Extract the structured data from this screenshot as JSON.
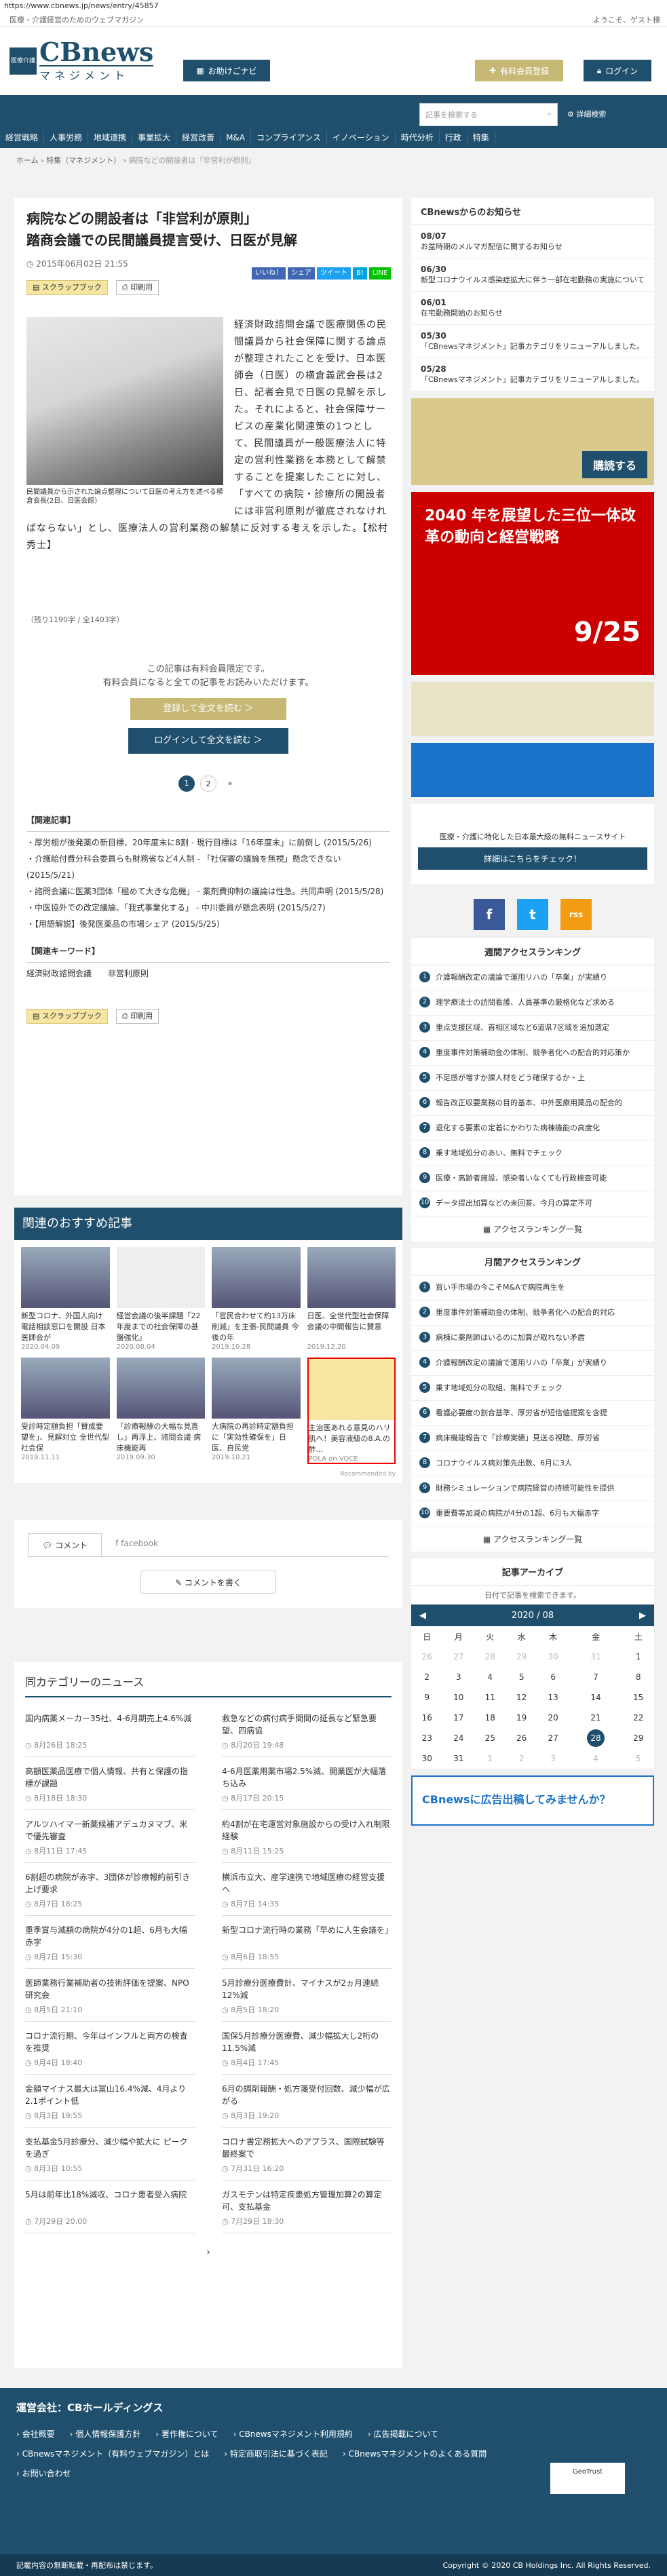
{
  "url": "https://www.cbnews.jp/news/entry/45857",
  "top": {
    "tagline": "医療・介護経営のためのウェブマガジン",
    "welcome": "ようこそ、ゲスト様"
  },
  "header": {
    "logo_badge": "医療介護",
    "logo_name": "CBnews",
    "logo_sub": "マネジメント",
    "nav_btn": "お助けごナビ",
    "paid": "有料会員登録",
    "login": "ログイン"
  },
  "nav": {
    "search_placeholder": "記事を検索する",
    "advanced": "詳細検索",
    "items": [
      "経営戦略",
      "人事労務",
      "地域連携",
      "事業拡大",
      "経営改善",
      "M&A",
      "コンプライアンス",
      "イノベーション",
      "時代分析",
      "行政",
      "特集"
    ]
  },
  "breadcrumb": {
    "home": "ホーム",
    "section": "特集（マネジメント）",
    "current": "病院などの開設者は「非営利が原則」"
  },
  "article": {
    "title1": "病院などの開設者は「非営利が原則」",
    "title2": "踏商会議での民間議員提言受け、日医が見解",
    "date": "2015年06月02日 21:55",
    "share": [
      "いいね！",
      "シェア",
      "ツイート",
      "B!",
      "LINE"
    ],
    "scrap": "スクラップブック",
    "print": "印刷用",
    "caption": "民間議員から示された論点整理について日医の考え方を述べる横倉会長(2日、日医会館)",
    "body": "経済財政諮問会議で医療関係の民間議員から社会保障に関する論点が整理されたことを受け、日本医師会（日医）の横倉義武会長は2日、記者会見で日医の見解を示した。それによると、社会保障サービスの産業化関連策の1つとして、民間議員が一般医療法人に特定の営利性業務を本務として解禁することを提案したことに対し、「すべての病院・診療所の開設者には非営利原則が徹底されなければならない」とし、医療法人の営利業務の解禁に反対する考えを示した。【松村秀士】",
    "remain": "（残り1190字 / 全1403字）",
    "members1": "この記事は有料会員限定です。",
    "members2": "有料会員になると全ての記事をお読みいただけます。",
    "read_btn": "登録して全文を読む ＞",
    "login_btn": "ログインして全文を読む ＞",
    "pages": [
      "1",
      "2",
      "»"
    ],
    "related_h": "【関連記事】",
    "related": [
      "厚労相が後発薬の新目標、20年度末に8割 - 現行目標は「16年度末」に前倒し (2015/5/26)",
      "介護給付費分科会委員らも財務省など4人制 - 「社保審の議論を無視」懸念できない (2015/5/21)",
      "諮問会議に医薬3団体「極めて大きな危機」 - 薬剤費抑制の議論は性急。共同声明 (2015/5/28)",
      "中医協外での改定議論、「我式事業化する」 - 中川委員が懸念表明 (2015/5/27)",
      "【用語解説】後発医薬品の市場シェア (2015/5/25)"
    ],
    "kw_h": "【関連キーワード】",
    "kw": [
      "経済財政諮問会議",
      "非営利原則"
    ]
  },
  "recommend": {
    "title": "関連のおすすめ記事",
    "items": [
      {
        "t": "新型コロナ、外国人向け電話相談窓口を開設 日本医師会が",
        "d": "2020.04.09"
      },
      {
        "t": "経営会議の後半課題「22年度までの社会保障の基盤強化」",
        "d": "2020.08.04"
      },
      {
        "t": "「官民合わせて約13万床削減」を主張-民間議員 今後の年",
        "d": "2019.10.28"
      },
      {
        "t": "日医、全世代型社会保障会議の中間報告に賛意",
        "d": "2019.12.20"
      },
      {
        "t": "受診時定額負担「賛成要望を」、見解対立 全世代型社会保",
        "d": "2019.11.11"
      },
      {
        "t": "「診療報酬の大幅な見直し」再浮上、諮問会議 病床機能再",
        "d": "2019.09.30"
      },
      {
        "t": "大病院の再診時定額負担に「実効性確保を」日医、自民党",
        "d": "2019.10.21"
      },
      {
        "t": "主治医あれる意見のハリ肌へ！美容液級の8.A.の酢...",
        "d": "POLA on VOCE"
      }
    ],
    "footnote": "Recommended by"
  },
  "comments": {
    "tab1": "コメント",
    "tab2": "facebook",
    "btn": "コメントを書く"
  },
  "news": {
    "title": "同カテゴリーのニュース",
    "items": [
      {
        "t": "国内病薬メーカー35社、4-6月期売上4.6%減",
        "d": "8月26日 18:25"
      },
      {
        "t": "救急などの病付病手間間の延長など緊急要望、四病協",
        "d": "8月20日 19:48"
      },
      {
        "t": "高額医薬品医療で個人情報、共有と保護の指標が課題",
        "d": "8月18日 18:30"
      },
      {
        "t": "4-6月医薬用薬市場2.5%減、開業医が大幅落ち込み",
        "d": "8月17日 20:15"
      },
      {
        "t": "アルツハイマー新薬候補アデュカヌマブ、米で優先審査",
        "d": "8月11日 17:45"
      },
      {
        "t": "約4割が在宅運営対象施設からの受け入れ制限経験",
        "d": "8月11日 15:25"
      },
      {
        "t": "6割超の病院が赤字、3団体が診療報約前引き上げ要求",
        "d": "8月7日 18:25"
      },
      {
        "t": "横浜市立大、産学連携で地域医療の経営支援へ",
        "d": "8月7日 14:35"
      },
      {
        "t": "重季賞与減額の病院が4分の1超、6月も大幅赤字",
        "d": "8月7日 15:30"
      },
      {
        "t": "新型コロナ流行時の業務「早めに人生会議を」",
        "d": "8月6日 18:55"
      },
      {
        "t": "医師業務行業補助者の技術評価を提案、NPO研究会",
        "d": "8月5日 21:10"
      },
      {
        "t": "5月診療分医療費計、マイナスが2ヵ月連続12%減",
        "d": "8月5日 18:20"
      },
      {
        "t": "コロナ流行期、今年はインフルと両方の検査を推奨",
        "d": "8月4日 18:40"
      },
      {
        "t": "国保5月診療分医療費、減少幅拡大し2桁の11.5%減",
        "d": "8月4日 17:45"
      },
      {
        "t": "金額マイナス最大は冨山16.4%減、4月より2.1ポイント低",
        "d": "8月3日 19:55"
      },
      {
        "t": "6月の調剤報酬・処方箋受付回数、減少幅が広がる",
        "d": "8月3日 19:20"
      },
      {
        "t": "支払基金5月診療分、減少幅や拡大に ピークを過ぎ",
        "d": "8月3日 10:55"
      },
      {
        "t": "コロナ書定務拡大へのアプラス、国際試験等最終案で",
        "d": "7月31日 16:20"
      },
      {
        "t": "5月は前年比18%減収、コロナ患者受入病院",
        "d": "7月29日 20:00"
      },
      {
        "t": "ガスモテンは特定疾患処方管理加算2の算定可、支払基金",
        "d": "7月29日 18:30"
      }
    ],
    "more": "›"
  },
  "side": {
    "notice_h": "CBnewsからのお知らせ",
    "notices": [
      {
        "d": "08/07",
        "t": "お盆時期のメルマガ配信に関するお知らせ"
      },
      {
        "d": "06/30",
        "t": "新型コロナウイルス感染症拡大に伴う一部在宅勤務の実施について"
      },
      {
        "d": "06/01",
        "t": "在宅勤務開始のお知らせ"
      },
      {
        "d": "05/30",
        "t": "「CBnewsマネジメント」記事カテゴリをリニューアルしました。"
      },
      {
        "d": "05/28",
        "t": "「CBnewsマネジメント」記事カテゴリをリニューアルしました。"
      }
    ],
    "ban1": "購読する",
    "ban2_t": "2040 年を展望した三位一体改革の動向と経営戦略",
    "ban2_d": "9/25",
    "ban3": "医療・介護に特化した日本最大級の無料ニュースサイト",
    "ban3_btn": "詳細はこちらをチェック！",
    "social": [
      "f",
      "t",
      "rss"
    ],
    "rank1_h": "週間アクセスランキング",
    "rank1": [
      "介護報酬改定の議論で運用リハの「卒業」が実績り",
      "理学療法士の訪問看護、人員基準の厳格化など求める",
      "重点支援区域、首相区域など6道県7区域を追加選定",
      "重度事件対策補助金の体制、競争者化への配合的対応策か",
      "不足感が増すか課人材をどう確保するか・上",
      "報告改正収要業務の目的基本、中外医療用薬品の配合的",
      "退化する要素の定着にかわりた病棟機能の高度化",
      "乗す地域処分のあい、無料でチェック",
      "医療・高齢者施設、感染者いなくても行政検査可能",
      "データ提出加算などの未回答、今月の算定不可"
    ],
    "rank_more": "アクセスランキング一覧",
    "rank2_h": "月間アクセスランキング",
    "rank2": [
      "買い手市場の今こそM&Aで病院再生を",
      "重度事件対策補助金の体制、競争者化への配合的対応",
      "病棟に薬剤師はいるのに加算が取れない矛盾",
      "介護報酬改定の議論で運用リハの「卒業」が実績り",
      "乗す地域処分の取組、無料でチェック",
      "看護必要度の割合基準、厚労省が短信値提案を含提",
      "病床機能報告で「診療実績」見送る視聴、厚労省",
      "コロナウイルス病対策先出数、6月に3人",
      "財務シミュレーションで病院経営の持続可能性を提供",
      "重要費等加減の病院が4分の1超、6月も大幅赤字"
    ],
    "archive_h": "記事アーカイブ",
    "archive_sub": "日付で記事を検索できます。",
    "month": "2020 / 08",
    "dow": [
      "日",
      "月",
      "火",
      "水",
      "木",
      "金",
      "土"
    ],
    "weeks": [
      [
        "26",
        "27",
        "28",
        "29",
        "30",
        "31",
        "1"
      ],
      [
        "2",
        "3",
        "4",
        "5",
        "6",
        "7",
        "8"
      ],
      [
        "9",
        "10",
        "11",
        "12",
        "13",
        "14",
        "15"
      ],
      [
        "16",
        "17",
        "18",
        "19",
        "20",
        "21",
        "22"
      ],
      [
        "23",
        "24",
        "25",
        "26",
        "27",
        "28",
        "29"
      ],
      [
        "30",
        "31",
        "1",
        "2",
        "3",
        "4",
        "5"
      ]
    ],
    "ad": "CBnewsに広告出稿してみませんか？"
  },
  "footer": {
    "company": "運営会社：CBホールディングス",
    "links": [
      "会社概要",
      "個人情報保護方針",
      "著作権について",
      "CBnewsマネジメント利用規約",
      "広告掲載について",
      "CBnewsマネジメント（有料ウェブマガジン）とは",
      "特定商取引法に基づく表記",
      "CBnewsマネジメントのよくある質問",
      "お問い合わせ"
    ],
    "note": "記載内容の無断転載・再配布は禁じます。",
    "copyright": "Copyright © 2020 CB Holdings Inc. All Rights Reserved.",
    "seal": "GeoTrust"
  }
}
